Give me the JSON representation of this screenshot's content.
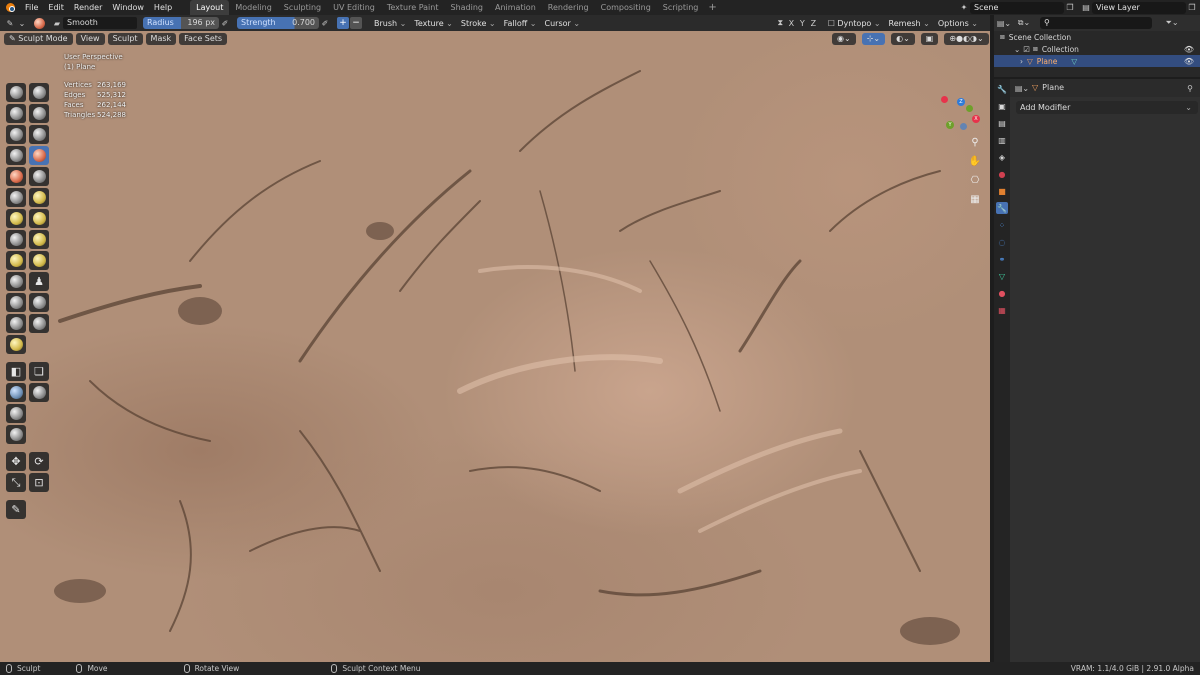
{
  "topbar": {
    "menus": [
      "File",
      "Edit",
      "Render",
      "Window",
      "Help"
    ],
    "workspaces": [
      "Layout",
      "Modeling",
      "Sculpting",
      "UV Editing",
      "Texture Paint",
      "Shading",
      "Animation",
      "Rendering",
      "Compositing",
      "Scripting"
    ],
    "active_workspace": "Layout",
    "add_label": "+",
    "scene": "Scene",
    "view_layer": "View Layer"
  },
  "toolbar": {
    "brush": "Smooth",
    "radius_label": "Radius",
    "radius_value": "196 px",
    "strength_label": "Strength",
    "strength_value": "0.700",
    "strength_fraction": 0.7,
    "plus": "+",
    "minus": "−",
    "dropdowns": [
      "Brush",
      "Texture",
      "Stroke",
      "Falloff",
      "Cursor"
    ],
    "axes": [
      "X",
      "Y",
      "Z"
    ],
    "dyntopo": "Dyntopo",
    "remesh": "Remesh",
    "options": "Options"
  },
  "viewport": {
    "mode": "Sculpt Mode",
    "menus": [
      "View",
      "Sculpt",
      "Mask",
      "Face Sets"
    ],
    "perspective": "User Perspective",
    "object": "(1) Plane",
    "stats": [
      {
        "label": "Vertices",
        "value": "263,169"
      },
      {
        "label": "Edges",
        "value": "525,312"
      },
      {
        "label": "Faces",
        "value": "262,144"
      },
      {
        "label": "Triangles",
        "value": "524,288"
      }
    ],
    "gizmo": {
      "x": "X",
      "y": "Y",
      "z": "Z"
    },
    "colors": {
      "x_axis": "#e7334b",
      "y_axis": "#6ea02a",
      "z_axis": "#2f7bd8",
      "skin": "#b08f78"
    }
  },
  "outliner": {
    "root": "Scene Collection",
    "collection": "Collection",
    "object": "Plane"
  },
  "properties": {
    "object": "Plane",
    "add_modifier": "Add Modifier"
  },
  "statusbar": {
    "items": [
      "Sculpt",
      "Move",
      "Rotate View",
      "Sculpt Context Menu"
    ],
    "right": "VRAM: 1.1/4.0 GiB | 2.91.0 Alpha"
  }
}
